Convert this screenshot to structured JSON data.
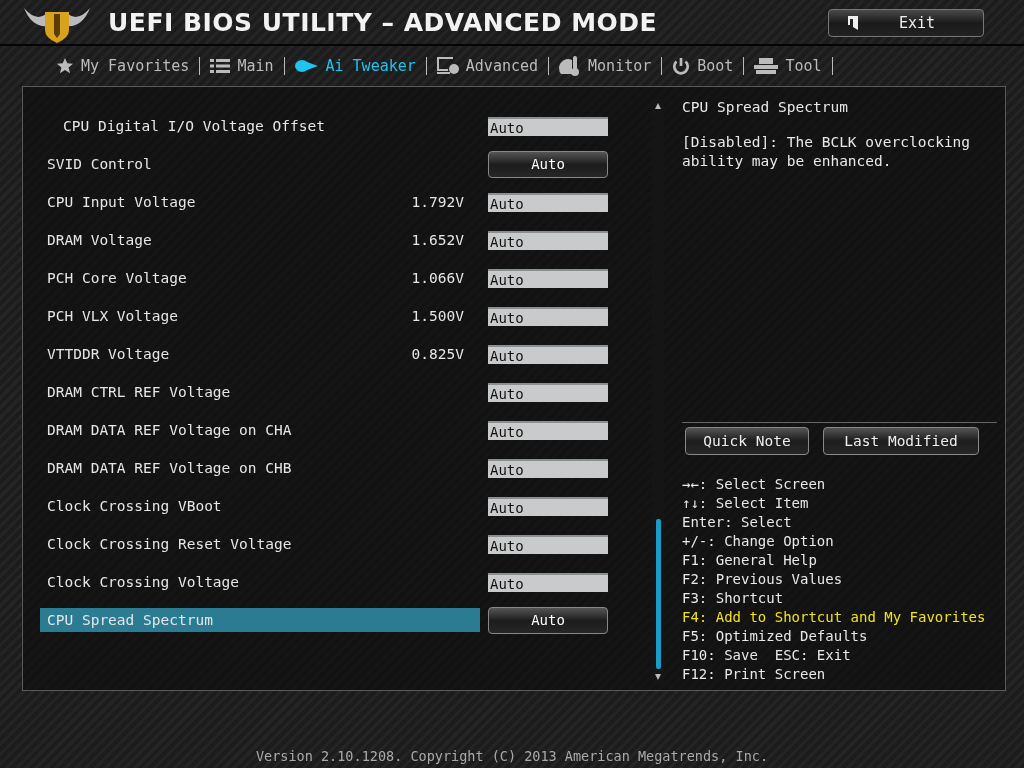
{
  "window": {
    "title": "UEFI BIOS UTILITY – ADVANCED MODE"
  },
  "exit_button": {
    "label": "Exit"
  },
  "tabs": [
    {
      "label": "My Favorites",
      "selected": false
    },
    {
      "label": "Main",
      "selected": false
    },
    {
      "label": "Ai Tweaker",
      "selected": true
    },
    {
      "label": "Advanced",
      "selected": false
    },
    {
      "label": "Monitor",
      "selected": false
    },
    {
      "label": "Boot",
      "selected": false
    },
    {
      "label": "Tool",
      "selected": false
    }
  ],
  "settings": [
    {
      "label": "CPU Digital I/O Voltage Offset",
      "kind": "field",
      "indented": true,
      "value": "Auto",
      "selected": false
    },
    {
      "label": "SVID Control",
      "kind": "dropdown",
      "indented": false,
      "value": "Auto",
      "selected": false
    },
    {
      "label": "CPU Input Voltage",
      "kind": "field",
      "indented": false,
      "reading": "1.792V",
      "value": "Auto",
      "selected": false
    },
    {
      "label": "DRAM Voltage",
      "kind": "field",
      "indented": false,
      "reading": "1.652V",
      "value": "Auto",
      "selected": false
    },
    {
      "label": "PCH Core Voltage",
      "kind": "field",
      "indented": false,
      "reading": "1.066V",
      "value": "Auto",
      "selected": false
    },
    {
      "label": "PCH VLX Voltage",
      "kind": "field",
      "indented": false,
      "reading": "1.500V",
      "value": "Auto",
      "selected": false
    },
    {
      "label": "VTTDDR Voltage",
      "kind": "field",
      "indented": false,
      "reading": "0.825V",
      "value": "Auto",
      "selected": false
    },
    {
      "label": "DRAM CTRL REF Voltage",
      "kind": "field",
      "indented": false,
      "value": "Auto",
      "selected": false
    },
    {
      "label": "DRAM DATA REF Voltage on CHA",
      "kind": "field",
      "indented": false,
      "value": "Auto",
      "selected": false
    },
    {
      "label": "DRAM DATA REF Voltage on CHB",
      "kind": "field",
      "indented": false,
      "value": "Auto",
      "selected": false
    },
    {
      "label": "Clock Crossing VBoot",
      "kind": "field",
      "indented": false,
      "value": "Auto",
      "selected": false
    },
    {
      "label": "Clock Crossing Reset Voltage",
      "kind": "field",
      "indented": false,
      "value": "Auto",
      "selected": false
    },
    {
      "label": "Clock Crossing Voltage",
      "kind": "field",
      "indented": false,
      "value": "Auto",
      "selected": false
    },
    {
      "label": "CPU Spread Spectrum",
      "kind": "dropdown",
      "indented": false,
      "value": "Auto",
      "selected": true
    }
  ],
  "help": {
    "title": "CPU Spread Spectrum",
    "text": "[Disabled]: The BCLK overclocking ability may be enhanced."
  },
  "help_buttons": [
    "Quick Note",
    "Last Modified"
  ],
  "key_hints": [
    {
      "text": "→←: Select Screen",
      "highlighted": false
    },
    {
      "text": "↑↓: Select Item",
      "highlighted": false
    },
    {
      "text": "Enter: Select",
      "highlighted": false
    },
    {
      "text": "+/-: Change Option",
      "highlighted": false
    },
    {
      "text": "F1: General Help",
      "highlighted": false
    },
    {
      "text": "F2: Previous Values",
      "highlighted": false
    },
    {
      "text": "F3: Shortcut",
      "highlighted": false
    },
    {
      "text": "F4: Add to Shortcut and My Favorites",
      "highlighted": true
    },
    {
      "text": "F5: Optimized Defaults",
      "highlighted": false
    },
    {
      "text": "F10: Save  ESC: Exit",
      "highlighted": false
    },
    {
      "text": "F12: Print Screen",
      "highlighted": false
    }
  ],
  "footer": "Version 2.10.1208. Copyright (C) 2013 American Megatrends, Inc."
}
